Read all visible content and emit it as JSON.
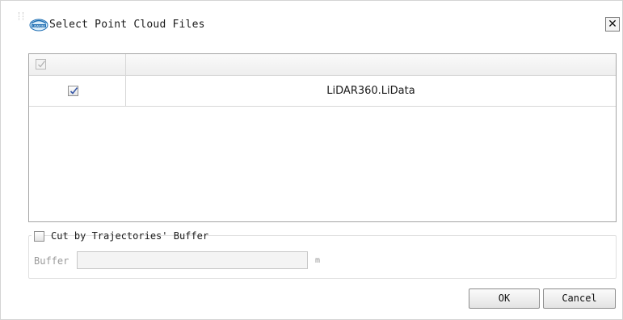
{
  "window": {
    "title": "Select Point Cloud Files",
    "logo_icon": "lidar360-logo-icon",
    "close_label": "✕"
  },
  "file_table": {
    "header_checkbox_checked": true,
    "header_checkbox_enabled": false,
    "columns": [
      "",
      ""
    ],
    "rows": [
      {
        "checked": true,
        "name": "LiDAR360.LiData"
      }
    ]
  },
  "cut_options": {
    "checkbox_checked": false,
    "checkbox_label": "Cut by Trajectories' Buffer",
    "buffer_label": "Buffer",
    "buffer_value": "",
    "buffer_unit": "m"
  },
  "footer": {
    "ok_label": "OK",
    "cancel_label": "Cancel"
  },
  "colors": {
    "border": "#a5a5a5",
    "check_mark": "#3a5aa8",
    "disabled_text": "#9a9a9a"
  }
}
